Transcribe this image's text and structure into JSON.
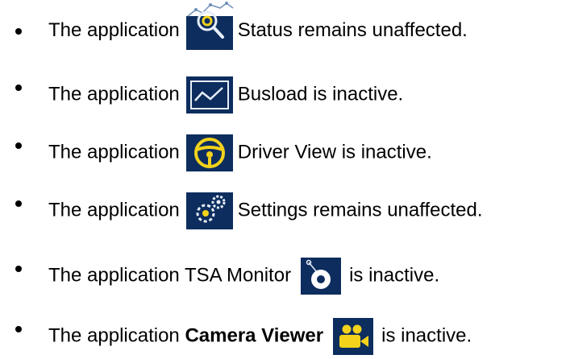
{
  "items": [
    {
      "prefix": "The application",
      "icon": "status-icon",
      "suffix": "Status remains unaffected."
    },
    {
      "prefix": "The application",
      "icon": "busload-icon",
      "suffix": "Busload is inactive."
    },
    {
      "prefix": "The application",
      "icon": "driver-view-icon",
      "suffix": "Driver View is inactive."
    },
    {
      "prefix": "The application",
      "icon": "settings-icon",
      "suffix": "Settings remains unaffected."
    },
    {
      "prefix": "The application TSA Monitor",
      "icon": "tsa-monitor-icon",
      "suffix": "is inactive."
    },
    {
      "prefix": "The application",
      "bold": "Camera Viewer",
      "icon": "camera-viewer-icon",
      "suffix": "is inactive."
    }
  ],
  "colors": {
    "icon_background": "#0d2d5e",
    "icon_accent": "#f2d21b",
    "icon_light": "#e6eef8",
    "text": "#000000"
  }
}
